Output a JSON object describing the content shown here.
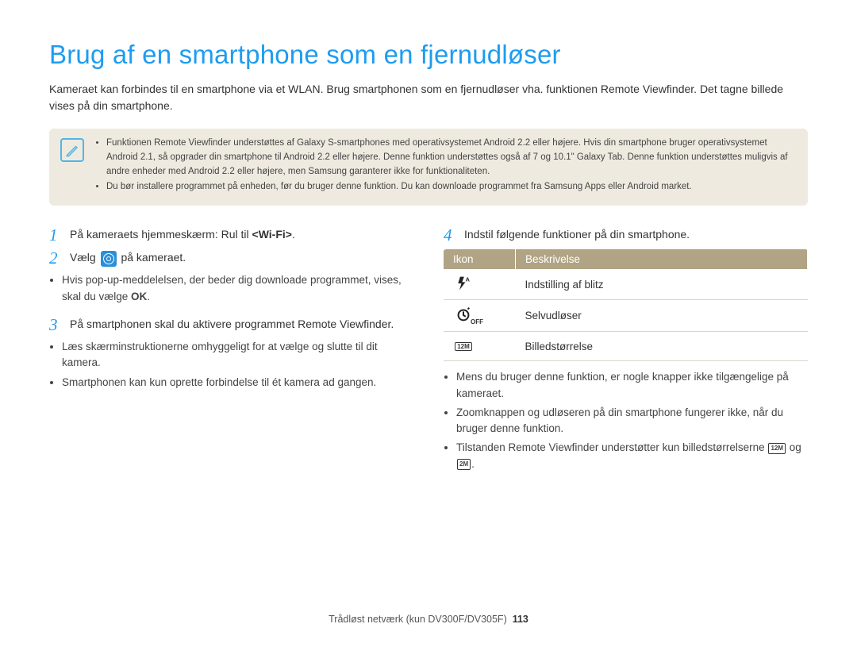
{
  "title": "Brug af en smartphone som en fjernudløser",
  "intro": "Kameraet kan forbindes til en smartphone via et WLAN. Brug smartphonen som en fjernudløser vha. funktionen Remote Viewfinder. Det tagne billede vises på din smartphone.",
  "notes": [
    "Funktionen Remote Viewfinder understøttes af Galaxy S-smartphones med operativsystemet Android 2.2 eller højere. Hvis din smartphone bruger operativsystemet Android 2.1, så opgrader din smartphone til Android 2.2 eller højere. Denne funktion understøttes også af 7 og 10.1\" Galaxy Tab. Denne funktion understøttes muligvis af andre enheder med Android 2.2 eller højere, men Samsung garanterer ikke for funktionaliteten.",
    "Du bør installere programmet på enheden, før du bruger denne funktion. Du kan downloade programmet fra Samsung Apps eller Android market."
  ],
  "left": {
    "step1": {
      "num": "1",
      "pre": "På kameraets hjemmeskærm: Rul til ",
      "bold": "<Wi-Fi>",
      "post": "."
    },
    "step2": {
      "num": "2",
      "pre": "Vælg ",
      "post": " på kameraet."
    },
    "step2_sub": {
      "pre": "Hvis pop-up-meddelelsen, der beder dig downloade programmet, vises, skal du vælge ",
      "bold": "OK",
      "post": "."
    },
    "step3": {
      "num": "3",
      "text": "På smartphonen skal du aktivere programmet Remote Viewfinder."
    },
    "step3_subs": [
      "Læs skærminstruktionerne omhyggeligt for at vælge og slutte til dit kamera.",
      "Smartphonen kan kun oprette forbindelse til ét kamera ad gangen."
    ]
  },
  "right": {
    "step4": {
      "num": "4",
      "text": "Indstil følgende funktioner på din smartphone."
    },
    "table": {
      "head_icon": "Ikon",
      "head_desc": "Beskrivelse",
      "rows": [
        {
          "icon": "flash",
          "desc": "Indstilling af blitz"
        },
        {
          "icon": "timer",
          "desc": "Selvudløser"
        },
        {
          "icon": "size12",
          "desc": "Billedstørrelse"
        }
      ]
    },
    "bullets": [
      "Mens du bruger denne funktion, er nogle knapper ikke tilgængelige på kameraet.",
      "Zoomknappen og udløseren på din smartphone fungerer ikke, når du bruger denne funktion."
    ],
    "bullet3": {
      "pre": "Tilstanden Remote Viewfinder understøtter kun billedstørrelserne ",
      "mid": " og ",
      "post": "."
    }
  },
  "footer": {
    "text": "Trådløst netværk (kun DV300F/DV305F)",
    "page": "113"
  },
  "icon_labels": {
    "size12": "12M",
    "size2": "2M"
  }
}
